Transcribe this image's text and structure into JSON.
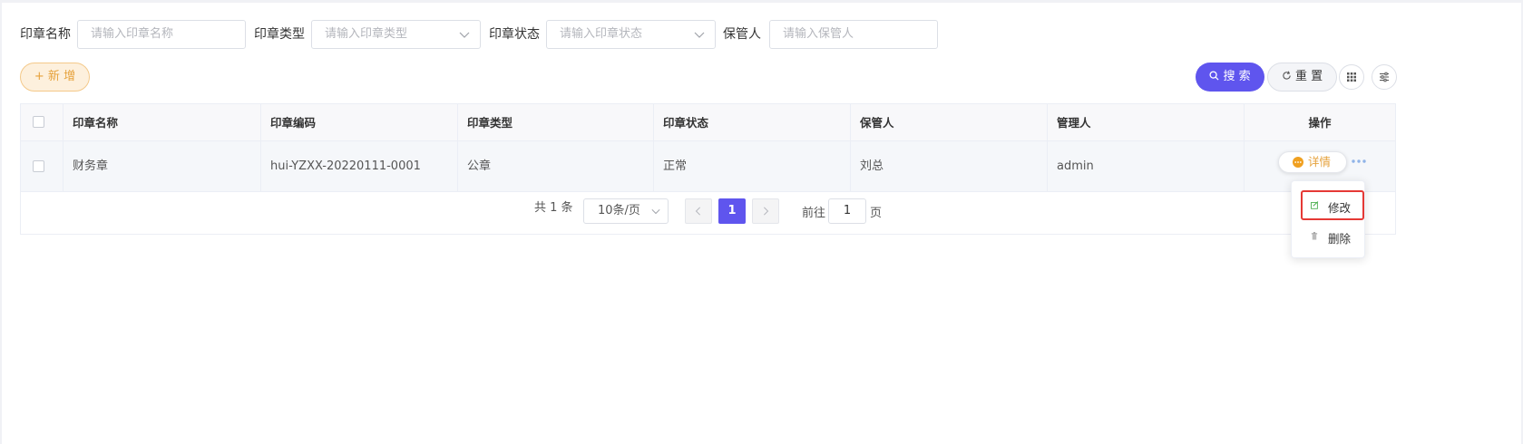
{
  "filters": [
    {
      "label": "印章名称",
      "placeholder": "请输入印章名称",
      "type": "input"
    },
    {
      "label": "印章类型",
      "placeholder": "请输入印章类型",
      "type": "select"
    },
    {
      "label": "印章状态",
      "placeholder": "请输入印章状态",
      "type": "select"
    },
    {
      "label": "保管人",
      "placeholder": "请输入保管人",
      "type": "input"
    }
  ],
  "toolbar": {
    "add_label": "+ 新 增",
    "search_label": "搜 索",
    "reset_label": "重 置"
  },
  "table": {
    "columns": [
      "印章名称",
      "印章编码",
      "印章类型",
      "印章状态",
      "保管人",
      "管理人",
      "操作"
    ],
    "rows": [
      {
        "name": "财务章",
        "code": "hui-YZXX-20220111-0001",
        "type": "公章",
        "status": "正常",
        "keeper": "刘总",
        "manager": "admin"
      }
    ],
    "detail_label": "详情"
  },
  "dropdown_menu": {
    "items": [
      {
        "label": "修改",
        "icon": "edit-icon",
        "highlighted": true
      },
      {
        "label": "删除",
        "icon": "trash-icon",
        "highlighted": false
      }
    ]
  },
  "pagination": {
    "total_text": "共 1 条",
    "page_size": "10条/页",
    "current_page": "1",
    "goto_prefix": "前往",
    "goto_value": "1",
    "goto_suffix": "页"
  },
  "colors": {
    "primary": "#5f55ee",
    "warning": "#e6a23c",
    "highlight_border": "#e53935"
  }
}
